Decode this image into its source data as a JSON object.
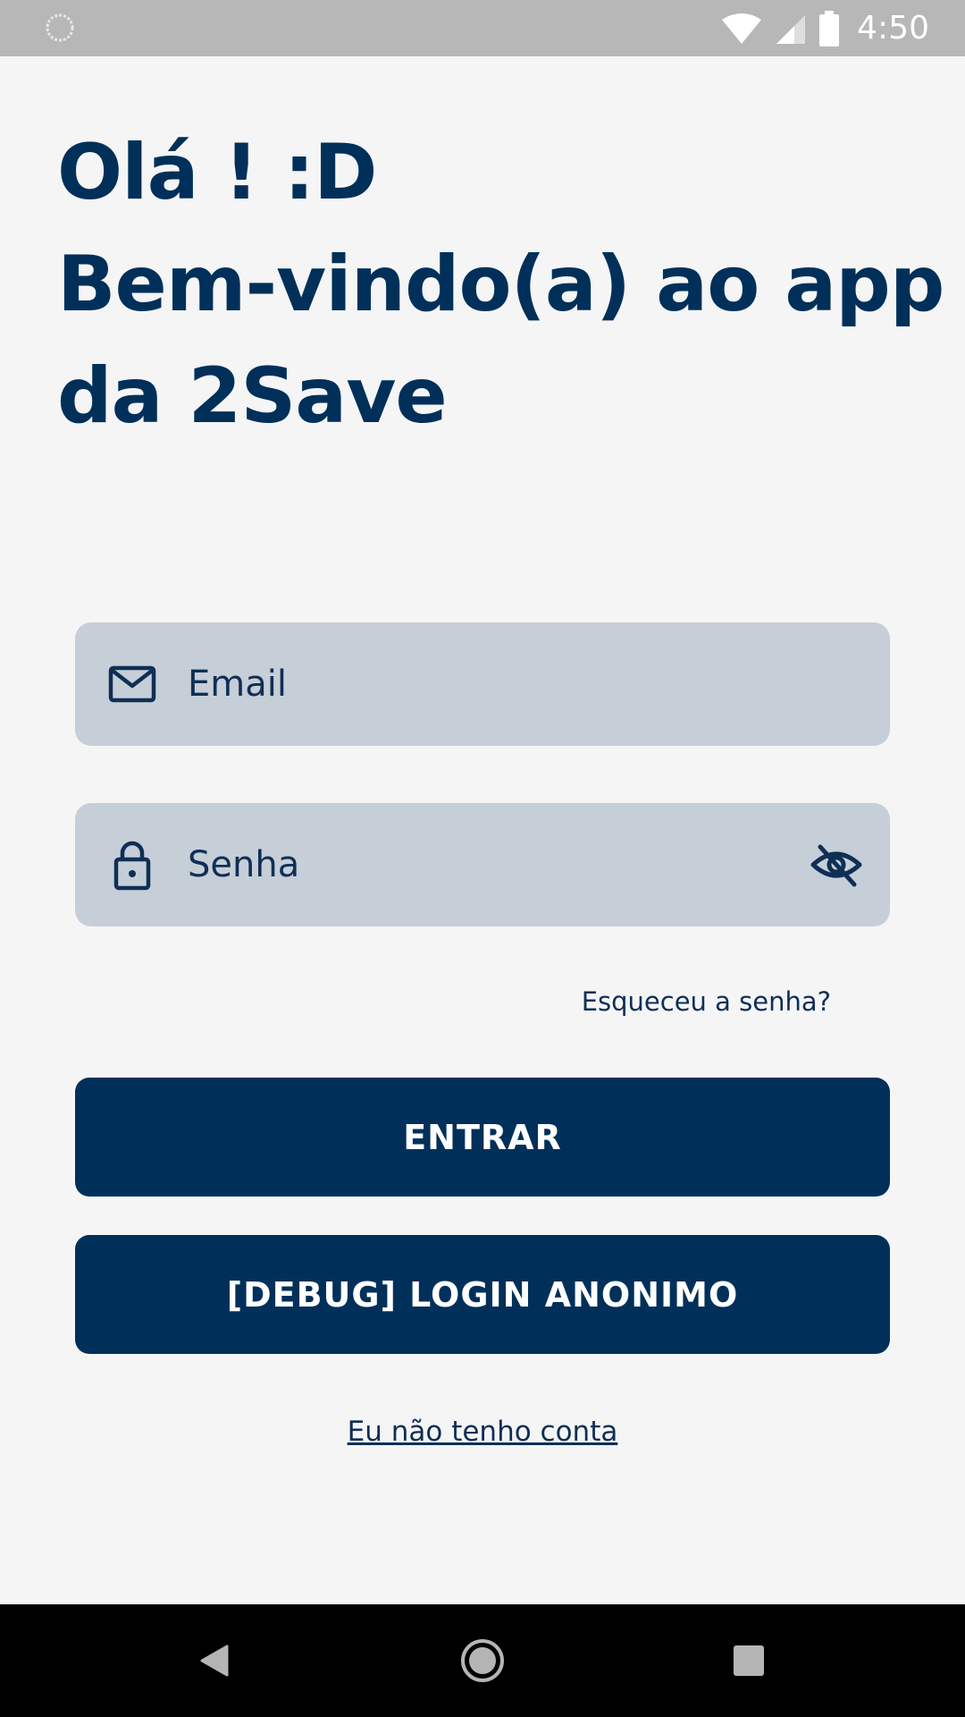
{
  "status_bar": {
    "time": "4:50"
  },
  "greeting": {
    "line1": "Olá ! :D",
    "line2": "Bem-vindo(a) ao app",
    "line3": "da 2Save"
  },
  "login_form": {
    "email": {
      "placeholder": "Email",
      "value": "",
      "icon": "mail-icon"
    },
    "password": {
      "placeholder": "Senha",
      "value": "",
      "icon": "lock-icon",
      "toggle_icon": "eye-off-icon"
    },
    "forgot_password_label": "Esqueceu a senha?",
    "enter_button_label": "ENTRAR",
    "debug_button_label": "[DEBUG] LOGIN ANONIMO",
    "signup_link_label": "Eu não tenho conta"
  },
  "colors": {
    "primary": "#003059",
    "field_background": "#c6ced8",
    "page_background": "#f5f5f6",
    "status_bar": "#b7b7b7"
  }
}
